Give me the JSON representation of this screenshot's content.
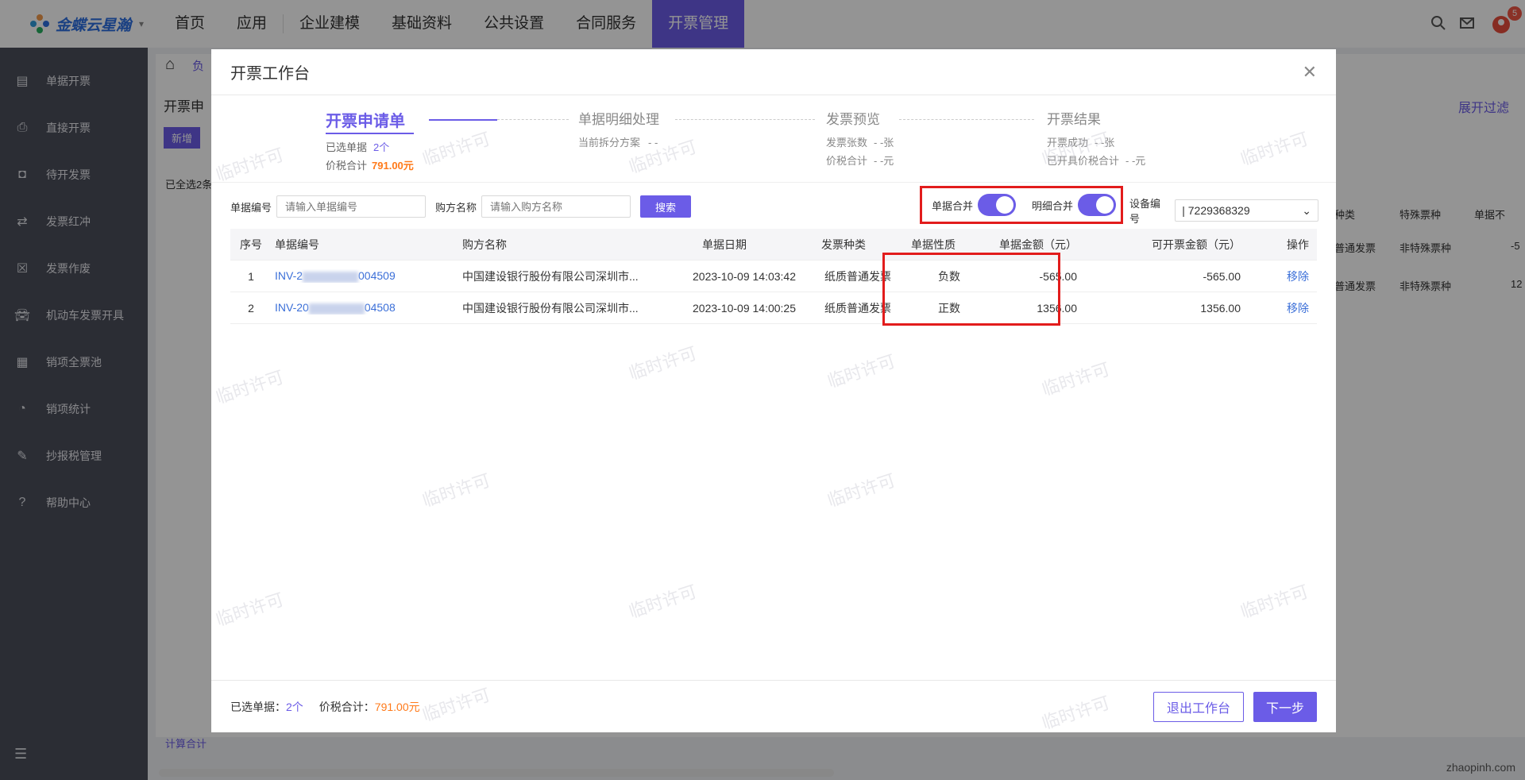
{
  "topbar": {
    "logo": "金蝶云星瀚",
    "nav": [
      "首页",
      "应用",
      "企业建模",
      "基础资料",
      "公共设置",
      "合同服务",
      "开票管理"
    ],
    "badge": "5"
  },
  "sidebar": [
    {
      "label": "单据开票",
      "icon": "document-icon"
    },
    {
      "label": "直接开票",
      "icon": "printer-icon"
    },
    {
      "label": "待开发票",
      "icon": "pending-icon"
    },
    {
      "label": "发票红冲",
      "icon": "exchange-icon"
    },
    {
      "label": "发票作废",
      "icon": "void-icon"
    },
    {
      "label": "机动车发票开具",
      "icon": "car-icon"
    },
    {
      "label": "销项全票池",
      "icon": "pool-icon"
    },
    {
      "label": "销项统计",
      "icon": "pie-icon"
    },
    {
      "label": "抄报税管理",
      "icon": "tax-icon"
    },
    {
      "label": "帮助中心",
      "icon": "help-icon"
    }
  ],
  "background": {
    "crumb": "负",
    "page_title": "开票申",
    "add_btn": "新增",
    "select_all": "已全选2条",
    "expand_filter": "展开过滤",
    "footer": "计算合计",
    "cols_right": [
      "种类",
      "特殊票种",
      "单据不"
    ],
    "rows_right": [
      [
        "普通发票",
        "非特殊票种",
        "-5"
      ],
      [
        "普通发票",
        "非特殊票种",
        "12"
      ]
    ]
  },
  "modal": {
    "title": "开票工作台",
    "steps": [
      {
        "title": "开票申请单",
        "rows": [
          {
            "label": "已选单据",
            "value": "2个"
          },
          {
            "label": "价税合计",
            "value": "791.00元"
          }
        ]
      },
      {
        "title": "单据明细处理",
        "rows": [
          {
            "label": "当前拆分方案",
            "value": "- -"
          }
        ]
      },
      {
        "title": "发票预览",
        "rows": [
          {
            "label": "发票张数",
            "value": "- -张"
          },
          {
            "label": "价税合计",
            "value": "- -元"
          }
        ]
      },
      {
        "title": "开票结果",
        "rows": [
          {
            "label": "开票成功",
            "value": "- -张"
          },
          {
            "label": "已开具价税合计",
            "value": "- -元"
          }
        ]
      }
    ],
    "search": {
      "bill_label": "单据编号",
      "bill_placeholder": "请输入单据编号",
      "buyer_label": "购方名称",
      "buyer_placeholder": "请输入购方名称",
      "search_btn": "搜索"
    },
    "toggles": {
      "bill_merge": "单据合并",
      "detail_merge": "明细合并"
    },
    "device": {
      "label": "设备编号",
      "value": "| 7229368329"
    },
    "table": {
      "headers": [
        "序号",
        "单据编号",
        "购方名称",
        "单据日期",
        "发票种类",
        "单据性质",
        "单据金额（元）",
        "可开票金额（元）",
        "操作"
      ],
      "rows": [
        {
          "idx": "1",
          "no_prefix": "INV-2",
          "no_suffix": "004509",
          "buyer": "中国建设银行股份有限公司深圳市...",
          "date": "2023-10-09 14:03:42",
          "type": "纸质普通发票",
          "nature": "负数",
          "amount": "-565.00",
          "available": "-565.00",
          "action": "移除"
        },
        {
          "idx": "2",
          "no_prefix": "INV-20",
          "no_suffix": "04508",
          "buyer": "中国建设银行股份有限公司深圳市...",
          "date": "2023-10-09 14:00:25",
          "type": "纸质普通发票",
          "nature": "正数",
          "amount": "1356.00",
          "available": "1356.00",
          "action": "移除"
        }
      ]
    },
    "footer": {
      "selected_label": "已选单据：",
      "selected_value": "2个",
      "total_label": "价税合计：",
      "total_value": "791.00元",
      "exit_btn": "退出工作台",
      "next_btn": "下一步"
    }
  },
  "watermark": "临时许可",
  "site": "zhaopinh.com"
}
